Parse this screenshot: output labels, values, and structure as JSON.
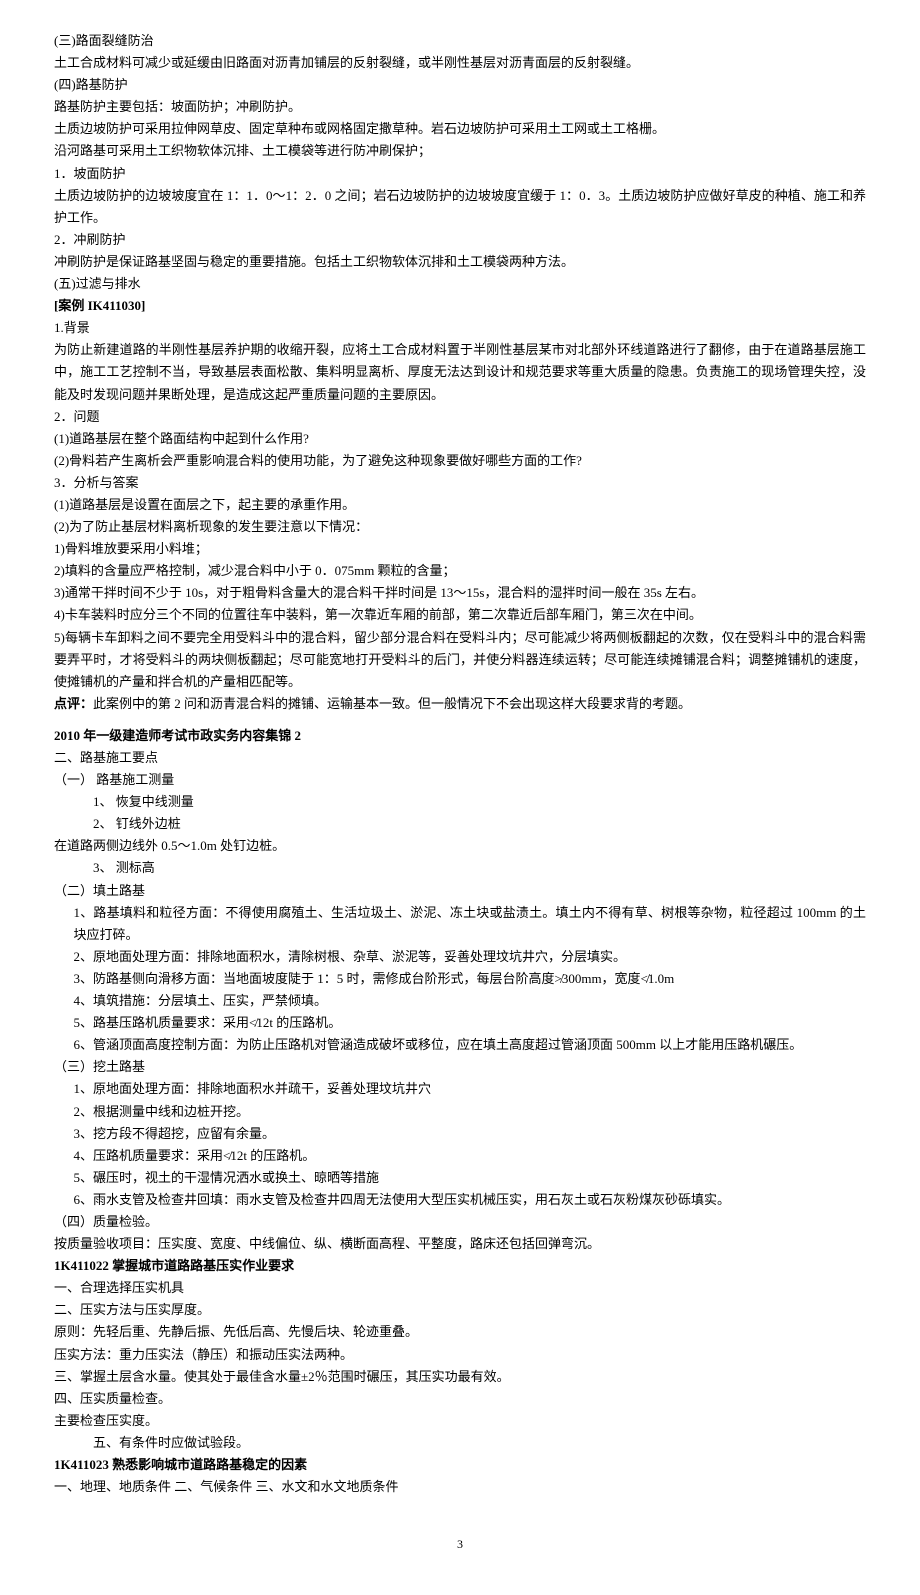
{
  "s1": {
    "h3": "(三)路面裂缝防治",
    "p1": "土工合成材料可减少或延缓由旧路面对沥青加铺层的反射裂缝，或半刚性基层对沥青面层的反射裂缝。",
    "h4": "(四)路基防护",
    "p2": "路基防护主要包括：坡面防护；冲刷防护。",
    "p3": "土质边坡防护可采用拉伸网草皮、固定草种布或网格固定撒草种。岩石边坡防护可采用土工网或土工格栅。",
    "p4": "沿河路基可采用土工织物软体沉排、土工模袋等进行防冲刷保护；",
    "p5": "1．坡面防护",
    "p6": "土质边坡防护的边坡坡度宜在 1：1．0～1：2．0 之间；岩石边坡防护的边坡坡度宜缓于 1：0．3。土质边坡防护应做好草皮的种植、施工和养护工作。",
    "p7": "2．冲刷防护",
    "p8": "冲刷防护是保证路基坚固与稳定的重要措施。包括土工织物软体沉排和土工模袋两种方法。",
    "h5": "(五)过滤与排水"
  },
  "case": {
    "title": "[案例 IK411030]",
    "bg_h": "1.背景",
    "bg_p": "为防止新建道路的半刚性基层养护期的收缩开裂，应将土工合成材料置于半刚性基层某市对北部外环线道路进行了翻修，由于在道路基层施工中，施工工艺控制不当，导致基层表面松散、集料明显离析、厚度无法达到设计和规范要求等重大质量的隐患。负责施工的现场管理失控，没能及时发现问题并果断处理，是造成这起严重质量问题的主要原因。",
    "q_h": "2．问题",
    "q1": "(1)道路基层在整个路面结构中起到什么作用?",
    "q2": "(2)骨料若产生离析会严重影响混合料的使用功能，为了避免这种现象要做好哪些方面的工作?",
    "a_h": "3．分析与答案",
    "a1": "(1)道路基层是设置在面层之下，起主要的承重作用。",
    "a2": "(2)为了防止基层材料离析现象的发生要注意以下情况：",
    "a2_1": "1)骨料堆放要采用小料堆；",
    "a2_2": "2)填料的含量应严格控制，减少混合料中小于 0．075mm 颗粒的含量；",
    "a2_3": "3)通常干拌时间不少于 10s，对于粗骨料含量大的混合料干拌时间是 13～15s，混合料的湿拌时间一般在 35s 左右。",
    "a2_4": "4)卡车装料时应分三个不同的位置往车中装料，第一次靠近车厢的前部，第二次靠近后部车厢门，第三次在中间。",
    "a2_5": "5)每辆卡车卸料之间不要完全用受料斗中的混合料，留少部分混合料在受料斗内；尽可能减少将两侧板翻起的次数，仅在受料斗中的混合料需要弄平时，才将受料斗的两块侧板翻起；尽可能宽地打开受料斗的后门，并使分料器连续运转；尽可能连续摊铺混合料；调整摊铺机的速度，使摊铺机的产量和拌合机的产量相匹配等。",
    "comment_label": "点评：",
    "comment_text": "此案例中的第 2 问和沥青混合料的摊铺、运输基本一致。但一般情况下不会出现这样大段要求背的考题。"
  },
  "s2": {
    "title": "2010 年一级建造师考试市政实务内容集锦 2",
    "p1": "二、路基施工要点",
    "h1": "（一）        路基施工测量",
    "i1": "1、    恢复中线测量",
    "i2": "2、    钉线外边桩",
    "p2": "在道路两侧边线外 0.5～1.0m 处钉边桩。",
    "i3": "3、    测标高",
    "h2": "（二）填土路基",
    "f1": "1、路基填料和粒径方面：不得使用腐殖土、生活垃圾土、淤泥、冻土块或盐渍土。填土内不得有草、树根等杂物，粒径超过 100mm 的土块应打碎。",
    "f2": "2、原地面处理方面：排除地面积水，清除树根、杂草、淤泥等，妥善处理坟坑井穴，分层填实。",
    "f3": "3、防路基侧向滑移方面：当地面坡度陡于 1：5 时，需修成台阶形式，每层台阶高度≯300mm，宽度≮1.0m",
    "f4": "4、填筑措施：分层填土、压实，严禁倾填。",
    "f5": "5、路基压路机质量要求：采用≮12t 的压路机。",
    "f6": "6、管涵顶面高度控制方面：为防止压路机对管涵造成破坏或移位，应在填土高度超过管涵顶面 500mm 以上才能用压路机碾压。",
    "h3": "（三）挖土路基",
    "e1": "1、原地面处理方面：排除地面积水并疏干，妥善处理坟坑井穴",
    "e2": "2、根据测量中线和边桩开挖。",
    "e3": "3、挖方段不得超挖，应留有余量。",
    "e4": "4、压路机质量要求：采用≮12t 的压路机。",
    "e5": "5、碾压时，视土的干湿情况洒水或换土、晾晒等措施",
    "e6": "6、雨水支管及检查井回填：雨水支管及检查井四周无法使用大型压实机械压实，用石灰土或石灰粉煤灰砂砾填实。",
    "h4": "（四）质量检验。",
    "p3": "按质量验收项目：压实度、宽度、中线偏位、纵、横断面高程、平整度，路床还包括回弹弯沉。"
  },
  "s3": {
    "title": "1K411022 掌握城市道路路基压实作业要求",
    "p1": "一、合理选择压实机具",
    "p2": "二、压实方法与压实厚度。",
    "p3": "原则：先轻后重、先静后振、先低后高、先慢后块、轮迹重叠。",
    "p4": "压实方法：重力压实法（静压）和振动压实法两种。",
    "p5": "三、掌握土层含水量。使其处于最佳含水量±2％范围时碾压，其压实功最有效。",
    "p6": "四、压实质量检查。",
    "p7": "主要检查压实度。",
    "p8": "五、有条件时应做试验段。"
  },
  "s4": {
    "title": "1K411023   熟悉影响城市道路路基稳定的因素",
    "p1": "一、地理、地质条件      二、气候条件       三、水文和水文地质条件"
  },
  "page": "3"
}
